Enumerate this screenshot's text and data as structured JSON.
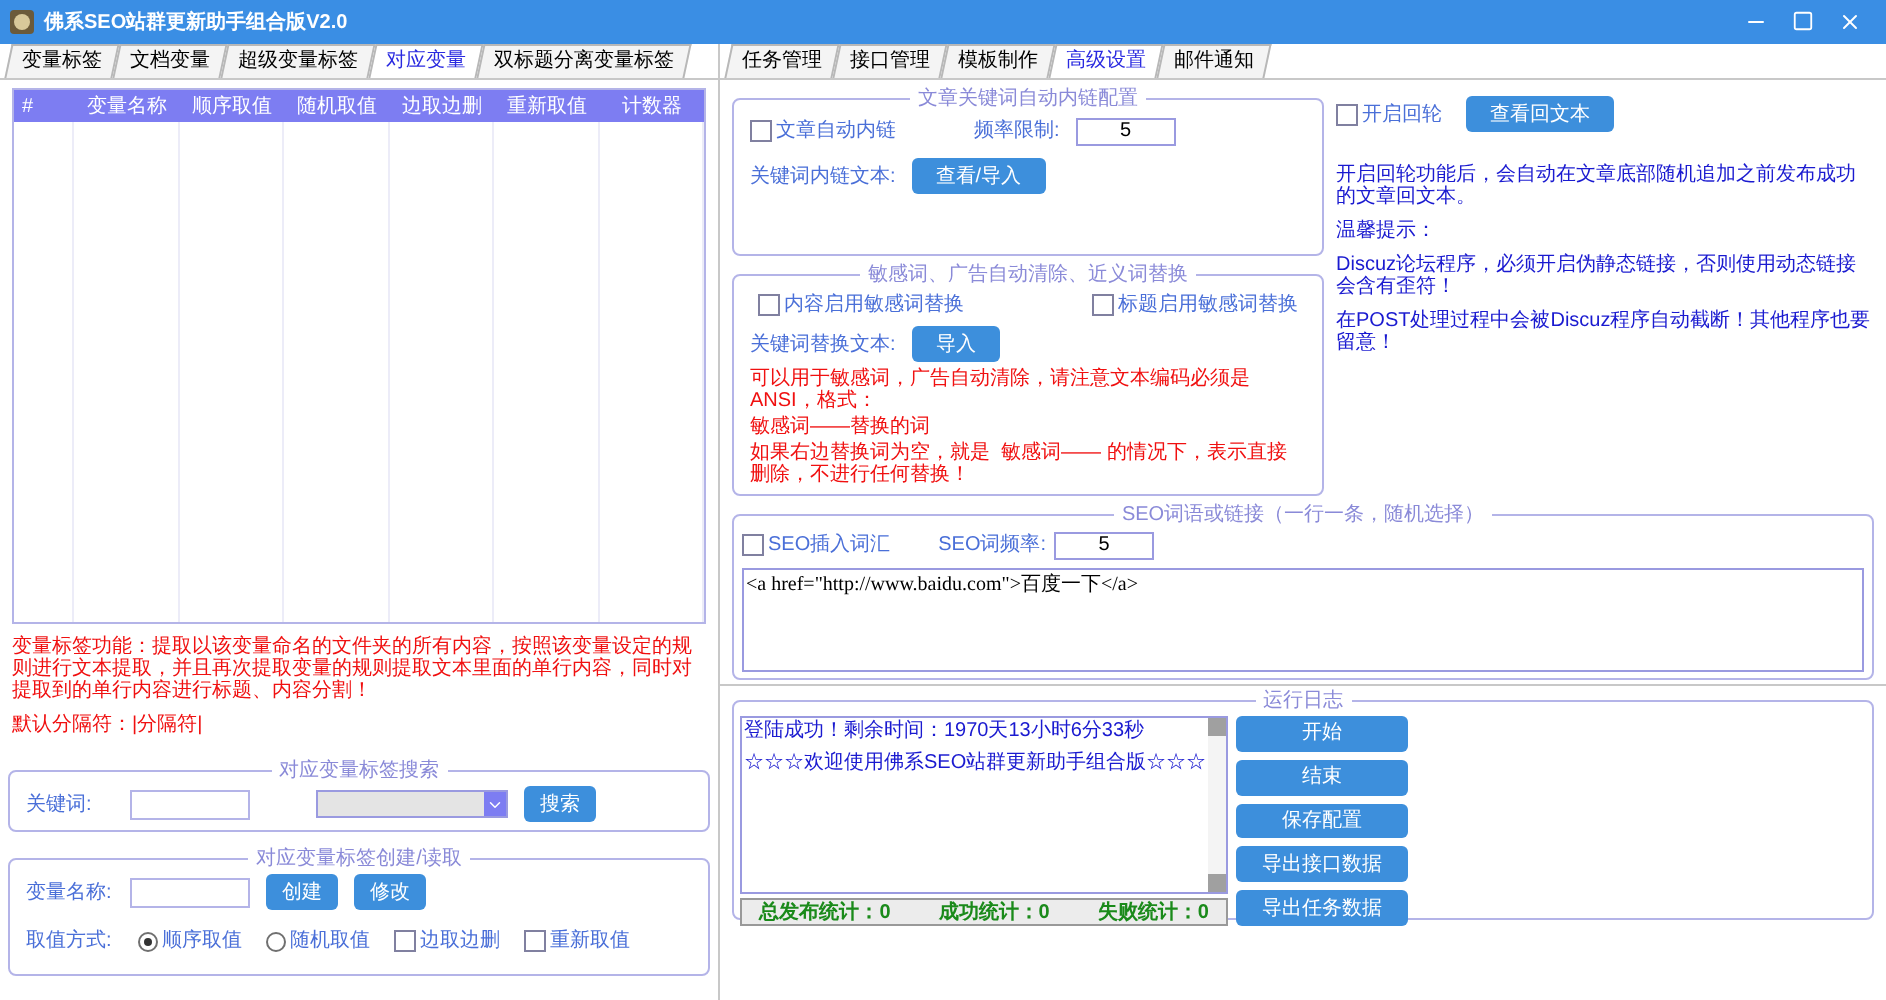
{
  "window": {
    "title": "佛系SEO站群更新助手组合版V2.0"
  },
  "left_tabs": [
    {
      "label": "变量标签",
      "selected": false
    },
    {
      "label": "文档变量",
      "selected": false
    },
    {
      "label": "超级变量标签",
      "selected": false
    },
    {
      "label": "对应变量",
      "selected": true
    },
    {
      "label": "双标题分离变量标签",
      "selected": false
    }
  ],
  "variable_table": {
    "columns": [
      "#",
      "变量名称",
      "顺序取值",
      "随机取值",
      "边取边删",
      "重新取值",
      "计数器"
    ]
  },
  "notes": [
    "变量标签功能：提取以该变量命名的文件夹的所有内容，按照该变量设定的规则进行文本提取，并且再次提取变量的规则提取文本里面的单行内容，同时对提取到的单行内容进行标题、内容分割！",
    "默认分隔符：|分隔符|"
  ],
  "search_group": {
    "title": "对应变量标签搜索",
    "keyword_label": "关键词:",
    "button": "搜索"
  },
  "create_group": {
    "title": "对应变量标签创建/读取",
    "name_label": "变量名称:",
    "buttons": [
      "创建",
      "修改"
    ],
    "mode_label": "取值方式:",
    "modes": [
      {
        "label": "顺序取值",
        "kind": "radio",
        "checked": true
      },
      {
        "label": "随机取值",
        "kind": "radio",
        "checked": false
      },
      {
        "label": "边取边删",
        "kind": "checkbox",
        "checked": false
      },
      {
        "label": "重新取值",
        "kind": "checkbox",
        "checked": false
      }
    ]
  },
  "right_tabs": [
    {
      "label": "任务管理",
      "selected": false
    },
    {
      "label": "接口管理",
      "selected": false
    },
    {
      "label": "模板制作",
      "selected": false
    },
    {
      "label": "高级设置",
      "selected": true
    },
    {
      "label": "邮件通知",
      "selected": false
    }
  ],
  "link_group": {
    "title": "文章关键词自动内链配置",
    "auto_link": {
      "label": "文章自动内链",
      "checked": false
    },
    "freq_label": "频率限制:",
    "freq_value": "5",
    "text_label": "关键词内链文本:",
    "button": "查看/导入"
  },
  "rotation": {
    "toggle": {
      "label": "开启回轮",
      "checked": false
    },
    "button": "查看回文本",
    "notes": [
      "开启回轮功能后，会自动在文章底部随机追加之前发布成功的文章回文本。",
      "温馨提示：",
      "Discuz论坛程序，必须开启伪静态链接，否则使用动态链接会含有歪符！",
      "在POST处理过程中会被Discuz程序自动截断！其他程序也要留意！"
    ]
  },
  "sensitive_group": {
    "title": "敏感词、广告自动清除、近义词替换",
    "options": [
      {
        "label": "内容启用敏感词替换",
        "checked": false
      },
      {
        "label": "标题启用敏感词替换",
        "checked": false
      }
    ],
    "text_label": "关键词替换文本:",
    "button": "导入",
    "notes": [
      "可以用于敏感词，广告自动清除，请注意文本编码必须是ANSI，格式：",
      "敏感词——替换的词",
      "如果右边替换词为空，就是  敏感词—— 的情况下，表示直接删除，不进行任何替换！"
    ]
  },
  "seo_group": {
    "title": "SEO词语或链接（一行一条，随机选择）",
    "insert": {
      "label": "SEO插入词汇",
      "checked": false
    },
    "freq_label": "SEO词频率:",
    "freq_value": "5",
    "content": "<a href=\"http://www.baidu.com\">百度一下</a>"
  },
  "log": {
    "title": "运行日志",
    "lines": [
      "登陆成功！剩余时间：1970天13小时6分33秒",
      "☆☆☆欢迎使用佛系SEO站群更新助手组合版☆☆☆"
    ],
    "stats": [
      "总发布统计：0",
      "成功统计：0",
      "失败统计：0"
    ]
  },
  "actions": [
    "开始",
    "结束",
    "保存配置",
    "导出接口数据",
    "导出任务数据"
  ]
}
